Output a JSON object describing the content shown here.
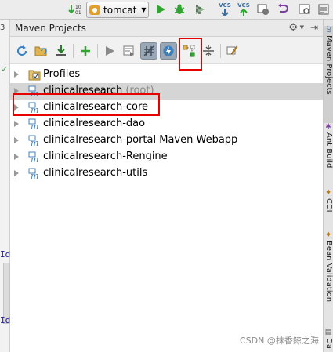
{
  "top_toolbar": {
    "run_config": "tomcat",
    "vcs_label_1": "VCS",
    "vcs_label_2": "VCS",
    "icons": [
      "sort-icon",
      "run-config-dropdown",
      "run-icon",
      "debug-icon",
      "coverage-icon",
      "vcs-update-icon",
      "vcs-commit-icon",
      "history-icon",
      "undo-icon",
      "search-icon"
    ]
  },
  "left_strip": {
    "line_num": "3",
    "code_1": "Id",
    "code_2": "Id"
  },
  "tool_window": {
    "title": "Maven Projects",
    "toolbar_icons": [
      "reimport-icon",
      "generate-sources-icon",
      "download-icon",
      "add-icon",
      "run-icon",
      "execute-goal-icon",
      "toggle-offline-icon",
      "skip-tests-icon",
      "show-dependencies-icon",
      "collapse-all-icon",
      "settings-icon"
    ],
    "tree": [
      {
        "label": "Profiles",
        "suffix": "",
        "icon": "profiles-folder-icon",
        "selected": false
      },
      {
        "label": "clinicalresearch",
        "suffix": "(root)",
        "icon": "maven-module-icon",
        "selected": true
      },
      {
        "label": "clinicalresearch-core",
        "suffix": "",
        "icon": "maven-module-icon",
        "selected": false
      },
      {
        "label": "clinicalresearch-dao",
        "suffix": "",
        "icon": "maven-module-icon",
        "selected": false
      },
      {
        "label": "clinicalresearch-portal Maven Webapp",
        "suffix": "",
        "icon": "maven-module-icon",
        "selected": false
      },
      {
        "label": "clinicalresearch-Rengine",
        "suffix": "",
        "icon": "maven-module-icon",
        "selected": false
      },
      {
        "label": "clinicalresearch-utils",
        "suffix": "",
        "icon": "maven-module-icon",
        "selected": false
      }
    ]
  },
  "right_strip": {
    "tabs": [
      "Maven Projects",
      "Ant Build",
      "CDI",
      "Bean Validation",
      "Da"
    ]
  },
  "watermark": "CSDN @抹香鲸之海",
  "colors": {
    "highlight": "#e60000",
    "selection": "#d5d5d5",
    "run_green": "#2fa52f",
    "maven_blue": "#4a7fb5"
  }
}
